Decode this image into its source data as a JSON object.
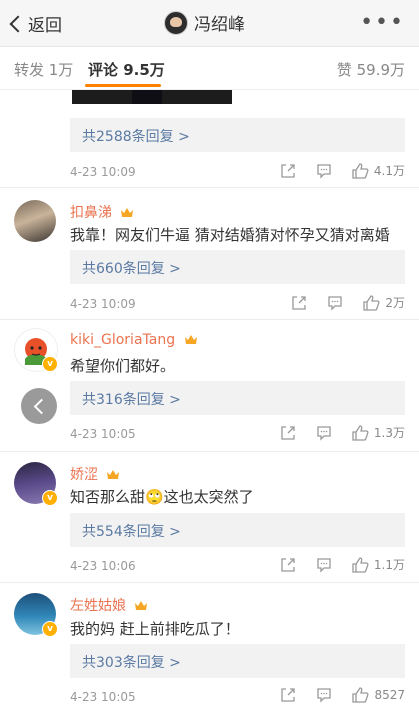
{
  "header": {
    "back_label": "返回",
    "user_name": "冯绍峰",
    "more_label": "•••"
  },
  "tabs": {
    "repost": "转发 1万",
    "comments": "评论 9.5万",
    "likes": "赞 59.9万"
  },
  "comments": [
    {
      "reply_text": "共2588条回复 >",
      "date": "4-23 10:09",
      "likes": "4.1万"
    },
    {
      "user": "扣鼻涕",
      "text": "我靠！网友们牛逼 猜对结婚猜对怀孕又猜对离婚",
      "reply_text": "共660条回复 >",
      "date": "4-23 10:09",
      "likes": "2万"
    },
    {
      "user": "kiki_GloriaTang",
      "text": "希望你们都好。",
      "reply_text": "共316条回复 >",
      "date": "4-23 10:05",
      "likes": "1.3万"
    },
    {
      "user": "娇涩",
      "text": "知否那么甜🙄这也太突然了",
      "reply_text": "共554条回复 >",
      "date": "4-23 10:06",
      "likes": "1.1万"
    },
    {
      "user": "左姓姑娘",
      "text": "我的妈 赶上前排吃瓜了！",
      "reply_text": "共303条回复 >",
      "date": "4-23 10:05",
      "likes": "8527"
    }
  ],
  "colors": {
    "username": "#eb7350",
    "reply_link": "#5b7aa3",
    "tab_accent": "#ff8200",
    "verified_badge": "#ffb000"
  }
}
